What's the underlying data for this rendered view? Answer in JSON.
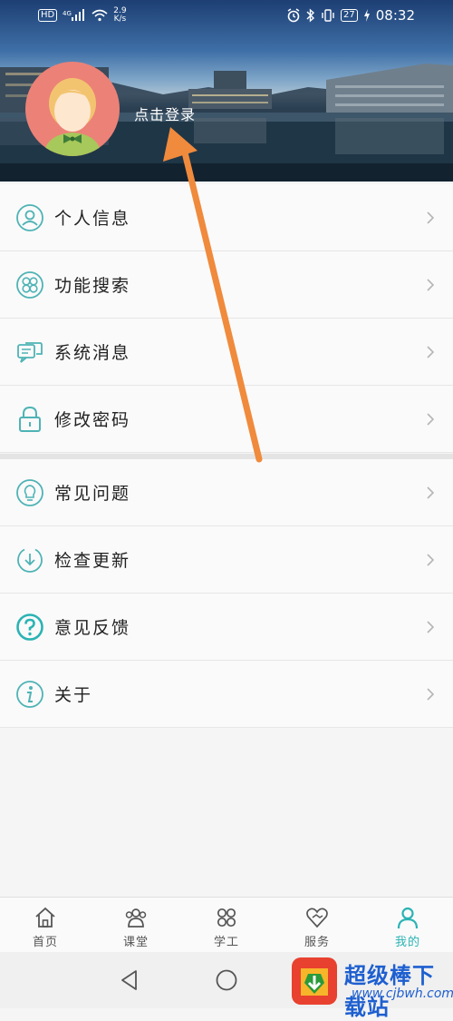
{
  "status_bar": {
    "network": "HD",
    "signal": "4G",
    "speed": "2.9",
    "speed_unit": "K/s",
    "battery": "27",
    "time": "08:32"
  },
  "header": {
    "login_text": "点击登录"
  },
  "menu": {
    "group1": [
      {
        "label": "个人信息",
        "icon": "person-icon"
      },
      {
        "label": "功能搜索",
        "icon": "grid-search-icon"
      },
      {
        "label": "系统消息",
        "icon": "message-icon"
      },
      {
        "label": "修改密码",
        "icon": "lock-icon"
      }
    ],
    "group2": [
      {
        "label": "常见问题",
        "icon": "lightbulb-icon"
      },
      {
        "label": "检查更新",
        "icon": "download-icon"
      },
      {
        "label": "意见反馈",
        "icon": "question-icon"
      },
      {
        "label": "关于",
        "icon": "info-icon"
      }
    ]
  },
  "tabbar": [
    {
      "label": "首页",
      "icon": "home-icon",
      "active": false
    },
    {
      "label": "课堂",
      "icon": "class-icon",
      "active": false
    },
    {
      "label": "学工",
      "icon": "apps-icon",
      "active": false
    },
    {
      "label": "服务",
      "icon": "heart-icon",
      "active": false
    },
    {
      "label": "我的",
      "icon": "profile-icon",
      "active": true
    }
  ],
  "watermark": {
    "text": "超级棒下载站",
    "url": "www.cjbwh.com"
  },
  "colors": {
    "accent": "#2bb3b4",
    "icon": "#4fb3b5",
    "arrow": "#f08a3c",
    "avatar_bg": "#ec8177"
  }
}
